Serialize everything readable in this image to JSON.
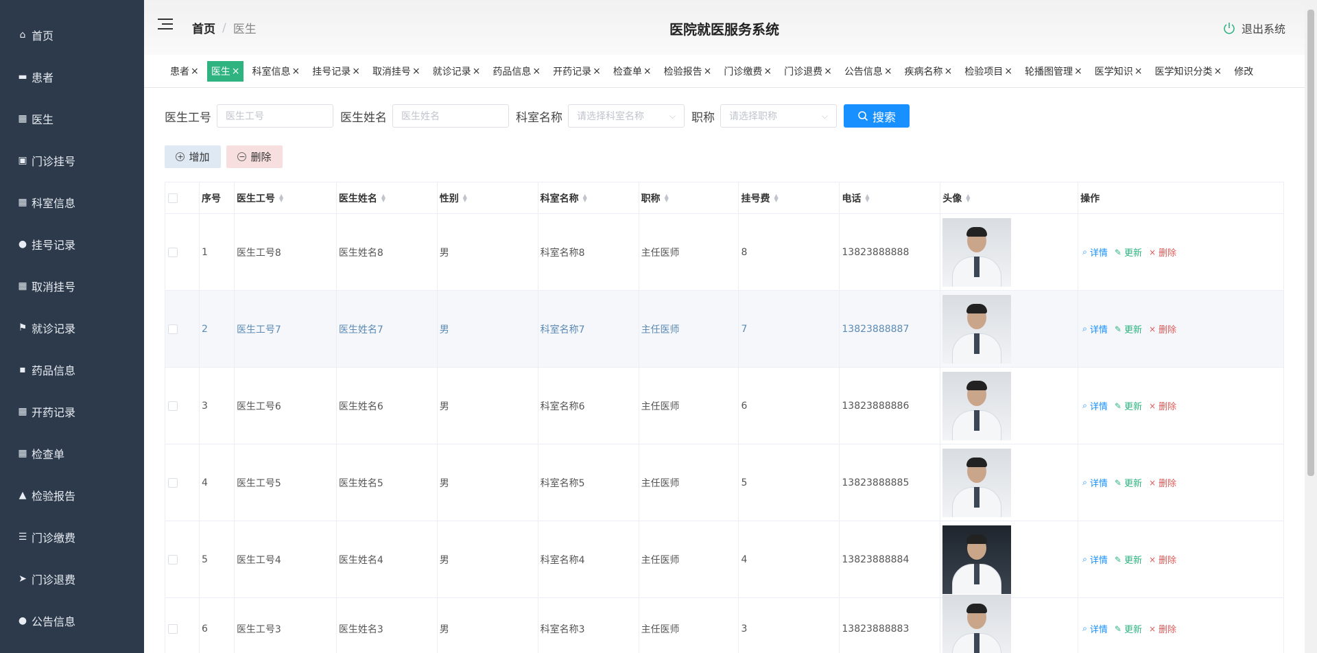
{
  "sidebar": {
    "items": [
      {
        "label": "首页",
        "icon": "home-icon",
        "glyph": "⌂"
      },
      {
        "label": "患者",
        "icon": "id-card-icon",
        "glyph": "▬"
      },
      {
        "label": "医生",
        "icon": "grid-icon",
        "glyph": "▦"
      },
      {
        "label": "门诊挂号",
        "icon": "clipboard-icon",
        "glyph": "▣"
      },
      {
        "label": "科室信息",
        "icon": "grid-icon",
        "glyph": "▦"
      },
      {
        "label": "挂号记录",
        "icon": "bulb-icon",
        "glyph": "●"
      },
      {
        "label": "取消挂号",
        "icon": "grid-icon",
        "glyph": "▦"
      },
      {
        "label": "就诊记录",
        "icon": "flag-icon",
        "glyph": "⚑"
      },
      {
        "label": "药品信息",
        "icon": "comment-icon",
        "glyph": "▪"
      },
      {
        "label": "开药记录",
        "icon": "grid-icon",
        "glyph": "▦"
      },
      {
        "label": "检查单",
        "icon": "grid-icon",
        "glyph": "▦"
      },
      {
        "label": "检验报告",
        "icon": "thumbs-up-icon",
        "glyph": "▲"
      },
      {
        "label": "门诊缴费",
        "icon": "list-icon",
        "glyph": "☰"
      },
      {
        "label": "门诊退费",
        "icon": "send-icon",
        "glyph": "➤"
      },
      {
        "label": "公告信息",
        "icon": "user-icon",
        "glyph": "●"
      }
    ]
  },
  "header": {
    "breadcrumb_home": "首页",
    "breadcrumb_sep": "/",
    "breadcrumb_current": "医生",
    "system_title": "医院就医服务系统",
    "logout_label": "退出系统"
  },
  "tabs": [
    {
      "label": "患者",
      "active": false
    },
    {
      "label": "医生",
      "active": true
    },
    {
      "label": "科室信息",
      "active": false
    },
    {
      "label": "挂号记录",
      "active": false
    },
    {
      "label": "取消挂号",
      "active": false
    },
    {
      "label": "就诊记录",
      "active": false
    },
    {
      "label": "药品信息",
      "active": false
    },
    {
      "label": "开药记录",
      "active": false
    },
    {
      "label": "检查单",
      "active": false
    },
    {
      "label": "检验报告",
      "active": false
    },
    {
      "label": "门诊缴费",
      "active": false
    },
    {
      "label": "门诊退费",
      "active": false
    },
    {
      "label": "公告信息",
      "active": false
    },
    {
      "label": "疾病名称",
      "active": false
    },
    {
      "label": "检验项目",
      "active": false
    },
    {
      "label": "轮播图管理",
      "active": false
    },
    {
      "label": "医学知识",
      "active": false
    },
    {
      "label": "医学知识分类",
      "active": false
    },
    {
      "label": "修改",
      "active": false
    }
  ],
  "search": {
    "doctor_no_label": "医生工号",
    "doctor_no_placeholder": "医生工号",
    "doctor_name_label": "医生姓名",
    "doctor_name_placeholder": "医生姓名",
    "dept_label": "科室名称",
    "dept_placeholder": "请选择科室名称",
    "title_label": "职称",
    "title_placeholder": "请选择职称",
    "search_button": "搜索"
  },
  "actions": {
    "add_label": "增加",
    "delete_label": "删除"
  },
  "table": {
    "headers": {
      "seq": "序号",
      "doctor_no": "医生工号",
      "doctor_name": "医生姓名",
      "sex": "性别",
      "dept": "科室名称",
      "title": "职称",
      "fee": "挂号费",
      "tel": "电话",
      "avatar": "头像",
      "ops": "操作"
    },
    "op_detail": "详情",
    "op_update": "更新",
    "op_delete": "删除",
    "rows": [
      {
        "seq": "1",
        "doctor_no": "医生工号8",
        "doctor_name": "医生姓名8",
        "sex": "男",
        "dept": "科室名称8",
        "title": "主任医师",
        "fee": "8",
        "tel": "13823888888"
      },
      {
        "seq": "2",
        "doctor_no": "医生工号7",
        "doctor_name": "医生姓名7",
        "sex": "男",
        "dept": "科室名称7",
        "title": "主任医师",
        "fee": "7",
        "tel": "13823888887"
      },
      {
        "seq": "3",
        "doctor_no": "医生工号6",
        "doctor_name": "医生姓名6",
        "sex": "男",
        "dept": "科室名称6",
        "title": "主任医师",
        "fee": "6",
        "tel": "13823888886"
      },
      {
        "seq": "4",
        "doctor_no": "医生工号5",
        "doctor_name": "医生姓名5",
        "sex": "男",
        "dept": "科室名称5",
        "title": "主任医师",
        "fee": "5",
        "tel": "13823888885"
      },
      {
        "seq": "5",
        "doctor_no": "医生工号4",
        "doctor_name": "医生姓名4",
        "sex": "男",
        "dept": "科室名称4",
        "title": "主任医师",
        "fee": "4",
        "tel": "13823888884"
      },
      {
        "seq": "6",
        "doctor_no": "医生工号3",
        "doctor_name": "医生姓名3",
        "sex": "男",
        "dept": "科室名称3",
        "title": "主任医师",
        "fee": "3",
        "tel": "13823888883"
      }
    ]
  },
  "colors": {
    "sidebar_bg": "#2d3a4b",
    "active_tab": "#2fb380",
    "primary": "#1890ff",
    "danger": "#e05a5a"
  }
}
